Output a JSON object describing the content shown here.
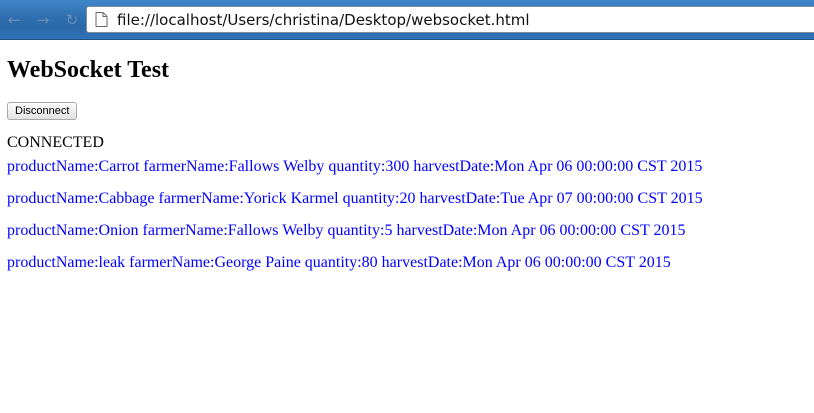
{
  "browser": {
    "address": "file://localhost/Users/christina/Desktop/websocket.html",
    "back_glyph": "←",
    "forward_glyph": "→",
    "reload_glyph": "↻"
  },
  "page": {
    "title": "WebSocket Test",
    "disconnect_label": "Disconnect",
    "status": "CONNECTED",
    "messages": [
      "productName:Carrot farmerName:Fallows Welby quantity:300 harvestDate:Mon Apr 06 00:00:00 CST 2015",
      "productName:Cabbage farmerName:Yorick Karmel quantity:20 harvestDate:Tue Apr 07 00:00:00 CST 2015",
      "productName:Onion farmerName:Fallows Welby quantity:5 harvestDate:Mon Apr 06 00:00:00 CST 2015",
      "productName:leak farmerName:George Paine quantity:80 harvestDate:Mon Apr 06 00:00:00 CST 2015"
    ],
    "message_color": "#0000ff"
  },
  "icons": {
    "back": "back-arrow-icon",
    "forward": "forward-arrow-icon",
    "reload": "reload-icon",
    "page": "page-icon"
  }
}
